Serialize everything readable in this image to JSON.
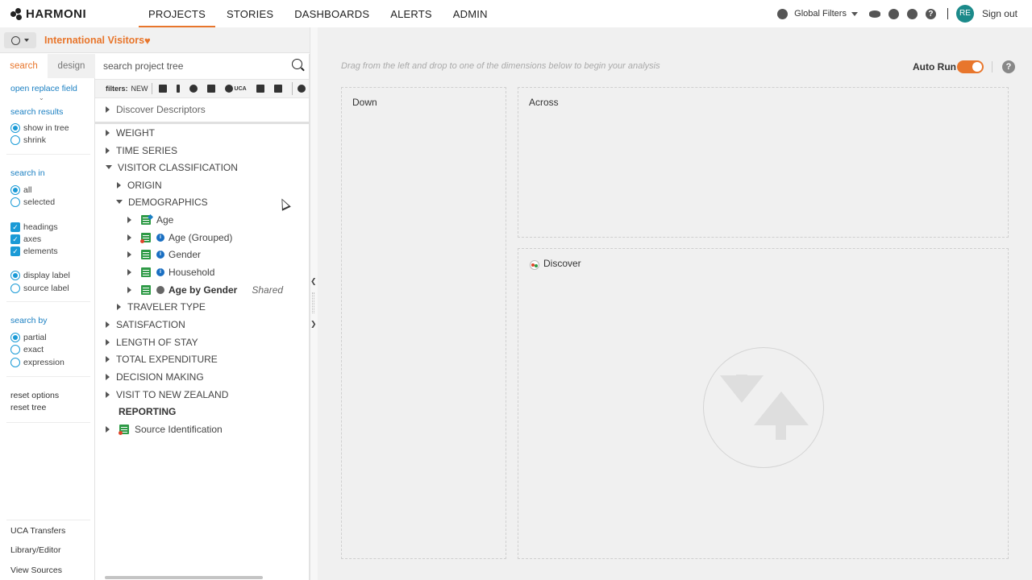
{
  "app": {
    "logo_text": "HARMONI"
  },
  "nav": {
    "items": [
      {
        "label": "PROJECTS",
        "active": true
      },
      {
        "label": "STORIES"
      },
      {
        "label": "DASHBOARDS"
      },
      {
        "label": "ALERTS"
      },
      {
        "label": "ADMIN"
      }
    ]
  },
  "topright": {
    "global_filters": "Global Filters",
    "help": "?",
    "avatar": "RE",
    "sign_out": "Sign out"
  },
  "project": {
    "title": "International Visitors"
  },
  "options": {
    "tabs": {
      "search": "search",
      "design": "design"
    },
    "open_replace_field": "open replace field",
    "search_results": {
      "heading": "search results",
      "options": [
        "show in tree",
        "shrink"
      ],
      "selected": "show in tree"
    },
    "search_in": {
      "heading": "search in",
      "options": [
        "all",
        "selected"
      ],
      "selected": "all"
    },
    "include": {
      "options": [
        "headings",
        "axes",
        "elements"
      ]
    },
    "label_mode": {
      "options": [
        "display label",
        "source label"
      ],
      "selected": "display label"
    },
    "search_by": {
      "heading": "search by",
      "options": [
        "partial",
        "exact",
        "expression"
      ],
      "selected": "partial"
    },
    "reset_options": "reset options",
    "reset_tree": "reset tree",
    "footer": [
      "UCA Transfers",
      "Library/Editor",
      "View Sources"
    ]
  },
  "tree": {
    "search_placeholder": "search project tree",
    "filters_label": "filters:",
    "filters_new": "NEW",
    "filters_uca": "UCA",
    "top_item": "Discover Descriptors",
    "items": [
      {
        "label": "WEIGHT"
      },
      {
        "label": "TIME SERIES"
      },
      {
        "label": "VISITOR CLASSIFICATION"
      },
      {
        "label": "ORIGIN"
      },
      {
        "label": "DEMOGRAPHICS"
      },
      {
        "label": "Age"
      },
      {
        "label": "Age (Grouped)"
      },
      {
        "label": "Gender"
      },
      {
        "label": "Household"
      },
      {
        "label": "Age by Gender",
        "tag": "Shared"
      },
      {
        "label": "TRAVELER TYPE"
      },
      {
        "label": "SATISFACTION"
      },
      {
        "label": "LENGTH OF STAY"
      },
      {
        "label": "TOTAL EXPENDITURE"
      },
      {
        "label": "DECISION MAKING"
      },
      {
        "label": "VISIT TO NEW ZEALAND"
      },
      {
        "label": "REPORTING"
      },
      {
        "label": "Source Identification"
      }
    ]
  },
  "canvas": {
    "hint": "Drag from the left and drop to one of the dimensions below to begin your analysis",
    "auto_run": "Auto Run",
    "auto_run_on": true,
    "help": "?",
    "zones": {
      "down": "Down",
      "across": "Across",
      "discover": "Discover"
    }
  },
  "colors": {
    "accent": "#e8762c",
    "link": "#1a7fc2",
    "avatar": "#1b8a8a",
    "element_icon": "#2e9a46"
  }
}
